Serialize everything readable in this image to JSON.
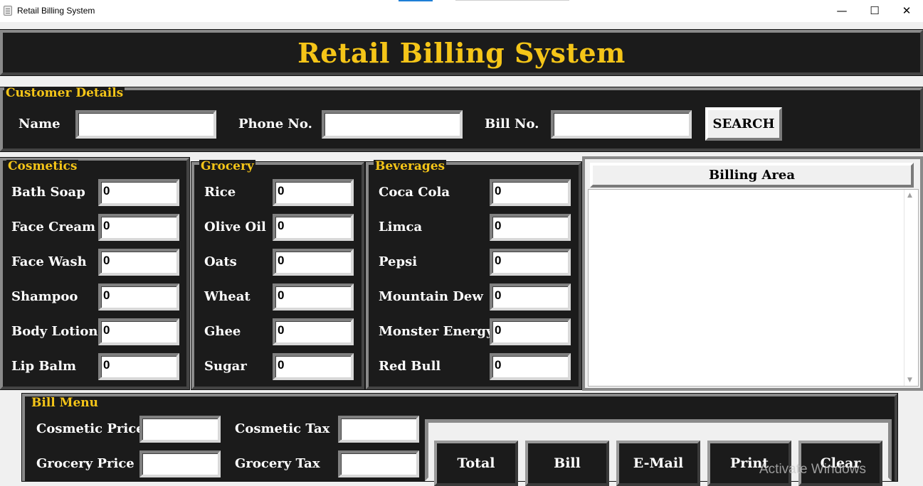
{
  "window": {
    "title": "Retail Billing System",
    "icon": "document-icon",
    "controls": {
      "minimize": "—",
      "maximize": "☐",
      "close": "✕"
    }
  },
  "colors": {
    "panel_bg": "#1b1b1b",
    "accent": "#f5c518",
    "label": "#ffffff",
    "page_bg": "#f0f0f0"
  },
  "header": {
    "title": "Retail Billing System"
  },
  "customer": {
    "legend": "Customer Details",
    "name_label": "Name",
    "name_value": "",
    "phone_label": "Phone No.",
    "phone_value": "",
    "bill_label": "Bill No.",
    "bill_value": "",
    "search_label": "SEARCH"
  },
  "cosmetics": {
    "legend": "Cosmetics",
    "items": [
      {
        "label": "Bath Soap",
        "value": "0"
      },
      {
        "label": "Face Cream",
        "value": "0"
      },
      {
        "label": "Face Wash",
        "value": "0"
      },
      {
        "label": "Shampoo",
        "value": "0"
      },
      {
        "label": "Body Lotion",
        "value": "0"
      },
      {
        "label": "Lip Balm",
        "value": "0"
      }
    ]
  },
  "grocery": {
    "legend": "Grocery",
    "items": [
      {
        "label": "Rice",
        "value": "0"
      },
      {
        "label": "Olive Oil",
        "value": "0"
      },
      {
        "label": "Oats",
        "value": "0"
      },
      {
        "label": "Wheat",
        "value": "0"
      },
      {
        "label": "Ghee",
        "value": "0"
      },
      {
        "label": "Sugar",
        "value": "0"
      }
    ]
  },
  "beverages": {
    "legend": "Beverages",
    "items": [
      {
        "label": "Coca Cola",
        "value": "0"
      },
      {
        "label": "Limca",
        "value": "0"
      },
      {
        "label": "Pepsi",
        "value": "0"
      },
      {
        "label": "Mountain Dew",
        "value": "0"
      },
      {
        "label": "Monster Energy",
        "value": "0"
      },
      {
        "label": "Red Bull",
        "value": "0"
      }
    ]
  },
  "billing": {
    "title": "Billing Area",
    "content": ""
  },
  "bill_menu": {
    "legend": "Bill Menu",
    "cosmetic_price_label": "Cosmetic Price",
    "cosmetic_price_value": "",
    "cosmetic_tax_label": "Cosmetic Tax",
    "cosmetic_tax_value": "",
    "grocery_price_label": "Grocery Price",
    "grocery_price_value": "",
    "grocery_tax_label": "Grocery Tax",
    "grocery_tax_value": ""
  },
  "actions": {
    "total": "Total",
    "bill": "Bill",
    "email": "E-Mail",
    "print": "Print",
    "clear": "Clear"
  },
  "watermark": "Activate Windows"
}
